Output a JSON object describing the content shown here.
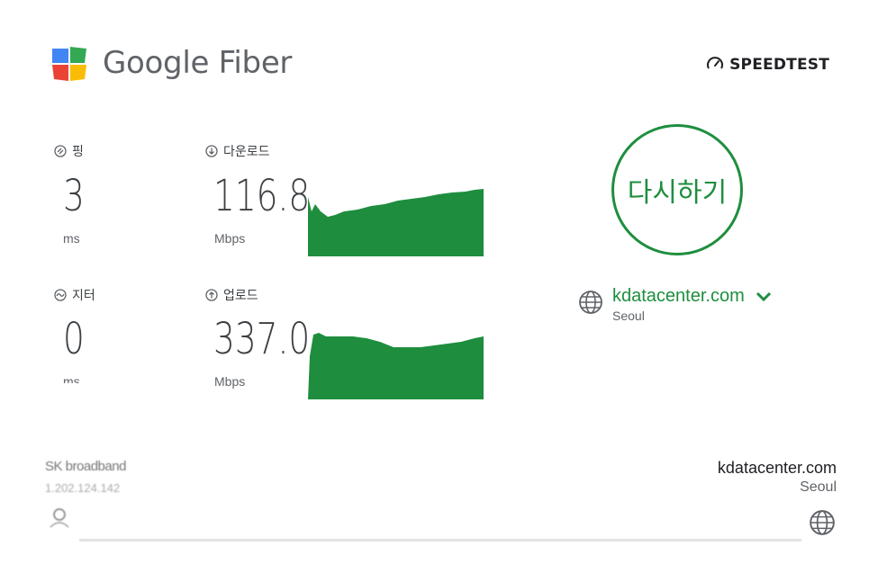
{
  "brand": {
    "name": "Google Fiber"
  },
  "speedtest_label": "SPEEDTEST",
  "metrics": {
    "ping": {
      "label": "핑",
      "value": "3",
      "unit": "ms"
    },
    "jitter": {
      "label": "지터",
      "value": "0",
      "unit": "ms"
    },
    "download": {
      "label": "다운로드",
      "value": "116.8",
      "unit": "Mbps"
    },
    "upload": {
      "label": "업로드",
      "value": "337.0",
      "unit": "Mbps"
    }
  },
  "retest_label": "다시하기",
  "server": {
    "name": "kdatacenter.com",
    "location": "Seoul"
  },
  "isp": {
    "name": "SK broadband",
    "ip": "1.202.124.142"
  },
  "colors": {
    "accent": "#1e8e3e",
    "graph": "#1e8e3e",
    "text": "#3c4043"
  },
  "icons": {
    "ping": "ping-icon",
    "jitter": "jitter-icon",
    "download": "download-arrow-icon",
    "upload": "upload-arrow-icon",
    "globe": "globe-icon",
    "chevron": "chevron-down-icon",
    "speedometer": "speedometer-icon",
    "user": "user-icon"
  }
}
